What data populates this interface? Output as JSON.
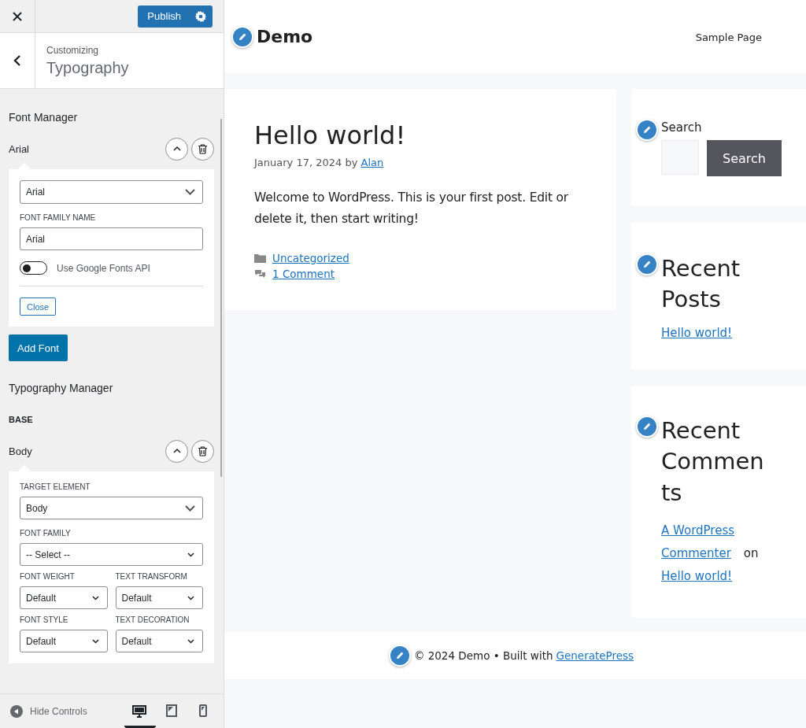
{
  "customizer": {
    "publish_button": "Publish",
    "breadcrumb": "Customizing",
    "section_title": "Typography",
    "font_manager": {
      "heading": "Font Manager",
      "fonts": [
        {
          "name": "Arial",
          "expanded": true,
          "select_value": "Arial",
          "family_label": "FONT FAMILY NAME",
          "family_value": "Arial",
          "google_toggle": {
            "label": "Use Google Fonts API",
            "on": false
          },
          "close_button": "Close"
        }
      ],
      "add_button": "Add Font"
    },
    "typography_manager": {
      "heading": "Typography Manager",
      "group": "BASE",
      "items": [
        {
          "name": "Body",
          "expanded": true,
          "fields": [
            {
              "label": "TARGET ELEMENT",
              "value": "Body"
            },
            {
              "label": "FONT FAMILY",
              "value": "-- Select --"
            },
            {
              "label": "FONT WEIGHT",
              "value": "Default"
            },
            {
              "label": "TEXT TRANSFORM",
              "value": "Default"
            },
            {
              "label": "FONT STYLE",
              "value": "Default"
            },
            {
              "label": "TEXT DECORATION",
              "value": "Default"
            }
          ]
        }
      ]
    },
    "footer": {
      "hide_controls": "Hide Controls",
      "devices": [
        {
          "kind": "desktop",
          "selected": true
        },
        {
          "kind": "tablet",
          "selected": false
        },
        {
          "kind": "mobile",
          "selected": false
        }
      ]
    }
  },
  "preview": {
    "site_title": "Demo",
    "nav": [
      "Sample Page"
    ],
    "post": {
      "title": "Hello world!",
      "date": "January 17, 2024",
      "by": "by",
      "author": "Alan",
      "body": "Welcome to WordPress. This is your first post. Edit or delete it, then start writing!",
      "category": "Uncategorized",
      "comments": "1 Comment"
    },
    "widgets": [
      {
        "kind": "search",
        "title": "Search",
        "button": "Search"
      },
      {
        "kind": "recent_posts",
        "title": "Recent Posts",
        "links": [
          "Hello world!"
        ]
      },
      {
        "kind": "recent_comments",
        "title": "Recent Comments",
        "author": "A WordPress Commenter",
        "on": "on",
        "post": "Hello world!"
      }
    ],
    "footer": {
      "text": "© 2024 Demo • Built with",
      "link": "GeneratePress"
    }
  }
}
